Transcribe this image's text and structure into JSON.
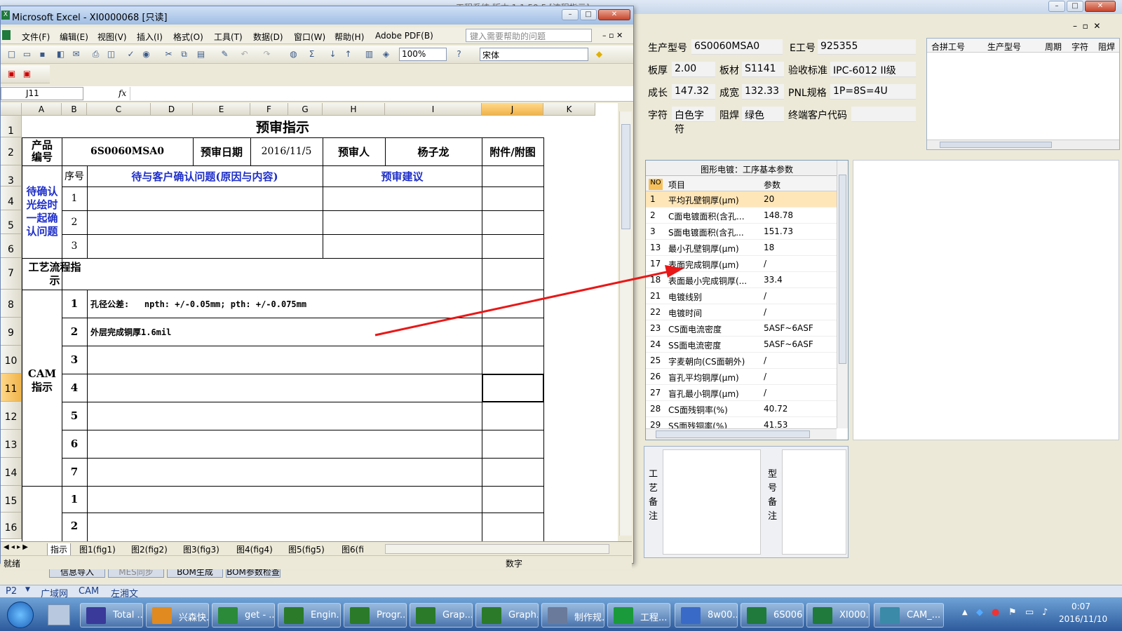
{
  "background_app": {
    "title_partial": "工程系统  版本 1.1.59.5  [流程指示]",
    "fields": {
      "model_label": "生产型号",
      "model_value": "6S0060MSA0",
      "ejob_label": "E工号",
      "ejob_value": "925355",
      "thickness_label": "板厚",
      "thickness_value": "2.00",
      "material_label": "板材",
      "material_value": "S1141",
      "standard_label": "验收标准",
      "standard_value": "IPC-6012 II级",
      "length_label": "成长",
      "length_value": "147.32",
      "width_label": "成宽",
      "width_value": "132.33",
      "pnl_label": "PNL规格",
      "pnl_value": "1P=8S=4U",
      "char_label": "字符",
      "char_value": "白色字符",
      "mask_label": "阻焊",
      "mask_value": "绿色",
      "customer_label": "终端客户代码",
      "customer_value": ""
    },
    "merge_table_headers": [
      "合拼工号",
      "生产型号",
      "周期",
      "字符",
      "阻焊"
    ],
    "param_table": {
      "title": "图形电镀：工序基本参数",
      "headers": [
        "NO",
        "项目",
        "参数"
      ],
      "rows": [
        {
          "no": "1",
          "item": "平均孔壁铜厚(μm)",
          "value": "20"
        },
        {
          "no": "2",
          "item": "C面电镀面积(含孔...",
          "value": "148.78"
        },
        {
          "no": "3",
          "item": "S面电镀面积(含孔...",
          "value": "151.73"
        },
        {
          "no": "13",
          "item": "最小孔壁铜厚(μm)",
          "value": "18"
        },
        {
          "no": "17",
          "item": "表面完成铜厚(μm)",
          "value": "/"
        },
        {
          "no": "18",
          "item": "表面最小完成铜厚(...",
          "value": "33.4"
        },
        {
          "no": "21",
          "item": "电镀线别",
          "value": "/"
        },
        {
          "no": "22",
          "item": "电镀时间",
          "value": "/"
        },
        {
          "no": "23",
          "item": "CS面电流密度",
          "value": "5ASF~6ASF"
        },
        {
          "no": "24",
          "item": "SS面电流密度",
          "value": "5ASF~6ASF"
        },
        {
          "no": "25",
          "item": "字麦朝向(CS面朝外)",
          "value": "/"
        },
        {
          "no": "26",
          "item": "盲孔平均铜厚(μm)",
          "value": "/"
        },
        {
          "no": "27",
          "item": "盲孔最小铜厚(μm)",
          "value": "/"
        },
        {
          "no": "28",
          "item": "CS面残铜率(%)",
          "value": "40.72"
        },
        {
          "no": "29",
          "item": "SS面残铜率(%)",
          "value": "41.53"
        }
      ]
    },
    "remark_process": "工艺备注",
    "remark_model": "型号备注",
    "bottom_buttons": [
      "信息导入",
      "MES同步",
      "BOM生成",
      "BOM参数检查"
    ],
    "bottom_tabs": [
      "P2",
      "广域网",
      "CAM",
      "左湘文"
    ]
  },
  "excel": {
    "title": "Microsoft Excel - XI0000068  [只读]",
    "menus": [
      "文件(F)",
      "编辑(E)",
      "视图(V)",
      "插入(I)",
      "格式(O)",
      "工具(T)",
      "数据(D)",
      "窗口(W)",
      "帮助(H)",
      "Adobe PDF(B)"
    ],
    "help_placeholder": "键入需要帮助的问题",
    "zoom": "100%",
    "font": "宋体",
    "name_box": "J11",
    "fx": "fx",
    "columns": [
      "A",
      "B",
      "C",
      "D",
      "E",
      "F",
      "G",
      "H",
      "I",
      "J",
      "K"
    ],
    "rows": [
      "1",
      "2",
      "3",
      "4",
      "5",
      "6",
      "7",
      "8",
      "9",
      "10",
      "11",
      "12",
      "13",
      "14",
      "15",
      "16"
    ],
    "sheet": {
      "title": "预审指示",
      "product_no_label": "产品编号",
      "product_no": "6S0060MSA0",
      "date_label": "预审日期",
      "date": "2016/11/5",
      "reviewer_label": "预审人",
      "reviewer": "杨子龙",
      "attachment_label": "附件/附图",
      "confirm_group": "待确认光绘时一起确认问题",
      "seq_label": "序号",
      "issue_header": "待与客户确认问题(原因与内容)",
      "suggest_header": "预审建议",
      "seq": [
        "1",
        "2",
        "3"
      ],
      "flow_label": "工艺流程指示",
      "cam_label": "CAM指示",
      "cam_seq": [
        "1",
        "2",
        "3",
        "4",
        "5",
        "6",
        "7"
      ],
      "cam_text_1": "孔径公差:   npth: +/-0.05mm; pth: +/-0.075mm",
      "cam_text_2": "外层完成铜厚1.6mil",
      "extra_seq": [
        "1",
        "2"
      ]
    },
    "sheet_tabs": [
      "指示",
      "图1(fig1)",
      "图2(fig2)",
      "图3(fig3)",
      "图4(fig4)",
      "图5(fig5)",
      "图6(fi"
    ],
    "status_left": "就绪",
    "status_num": "数字"
  },
  "taskbar": {
    "items": [
      "Total ...",
      "兴森快...",
      "get - ...",
      "Engin...",
      "Progr...",
      "Grap...",
      "Graph...",
      "制作规...",
      "工程...",
      "8w00...",
      "6S006...",
      "XI000...",
      "CAM_..."
    ],
    "time": "0:07",
    "date": "2016/11/10"
  },
  "colors": {
    "annotation_arrow": "#e81818",
    "blue_text": "#1f2fc8",
    "selected_header": "#f0b34a"
  }
}
